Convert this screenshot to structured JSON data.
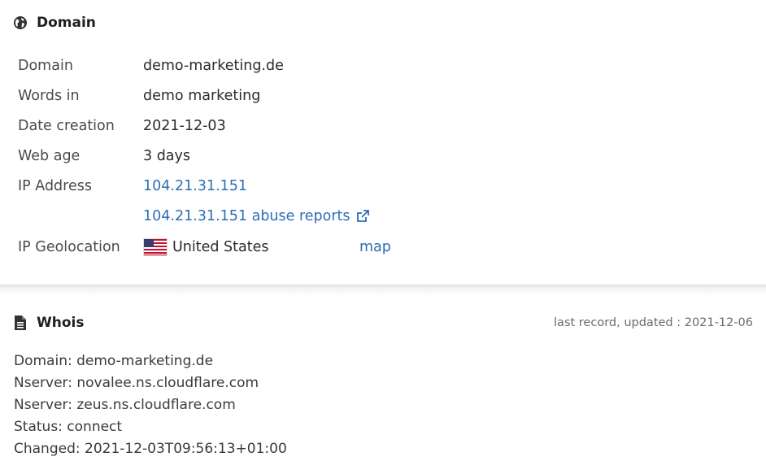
{
  "domain_section": {
    "title": "Domain",
    "rows": [
      {
        "label": "Domain",
        "value": "demo-marketing.de"
      },
      {
        "label": "Words in",
        "value": "demo marketing"
      },
      {
        "label": "Date creation",
        "value": "2021-12-03"
      },
      {
        "label": "Web age",
        "value": "3 days"
      },
      {
        "label": "IP Address",
        "value": "104.21.31.151"
      },
      {
        "label": "",
        "value": "104.21.31.151 abuse reports"
      },
      {
        "label": "IP Geolocation",
        "value": "United States",
        "map": "map"
      }
    ],
    "icons": {
      "section": "globe-icon",
      "external": "external-link-icon",
      "flag": "us-flag-icon"
    },
    "link_color": "#2f6db5"
  },
  "whois_section": {
    "title": "Whois",
    "updated": "last record, updated : 2021-12-06",
    "lines": [
      "Domain: demo-marketing.de",
      "Nserver: novalee.ns.cloudflare.com",
      "Nserver: zeus.ns.cloudflare.com",
      "Status: connect",
      "Changed: 2021-12-03T09:56:13+01:00"
    ],
    "icons": {
      "section": "document-icon"
    }
  }
}
